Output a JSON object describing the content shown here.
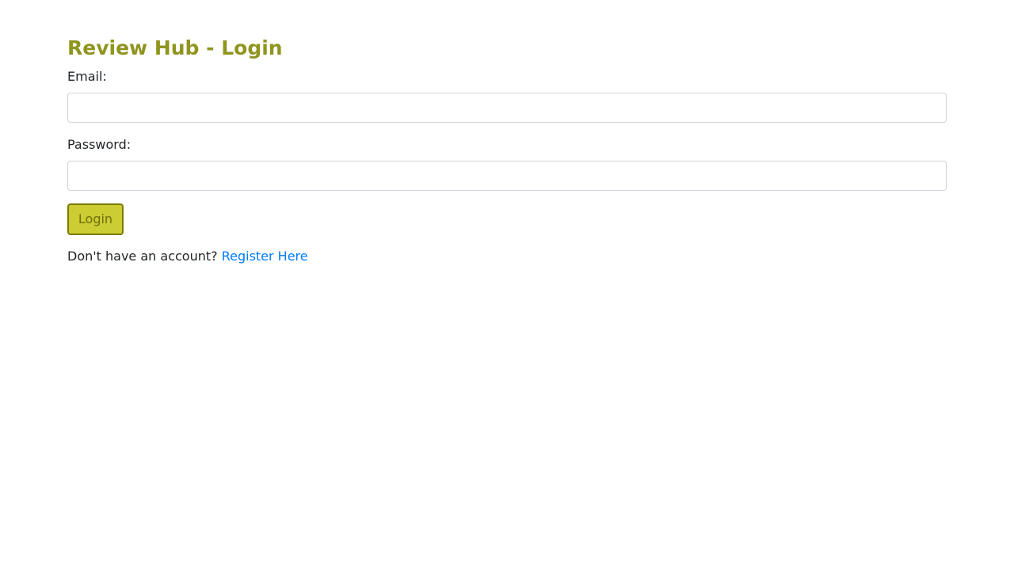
{
  "page": {
    "title": "Review Hub - Login"
  },
  "form": {
    "email_label": "Email:",
    "email_value": "",
    "password_label": "Password:",
    "password_value": "",
    "login_button_label": "Login"
  },
  "register": {
    "prompt": "Don't have an account?",
    "link_text": "Register Here"
  },
  "colors": {
    "title": "#8f951f",
    "button_bg": "#cccc33",
    "button_border": "#7a7a00",
    "link": "#007bff"
  }
}
